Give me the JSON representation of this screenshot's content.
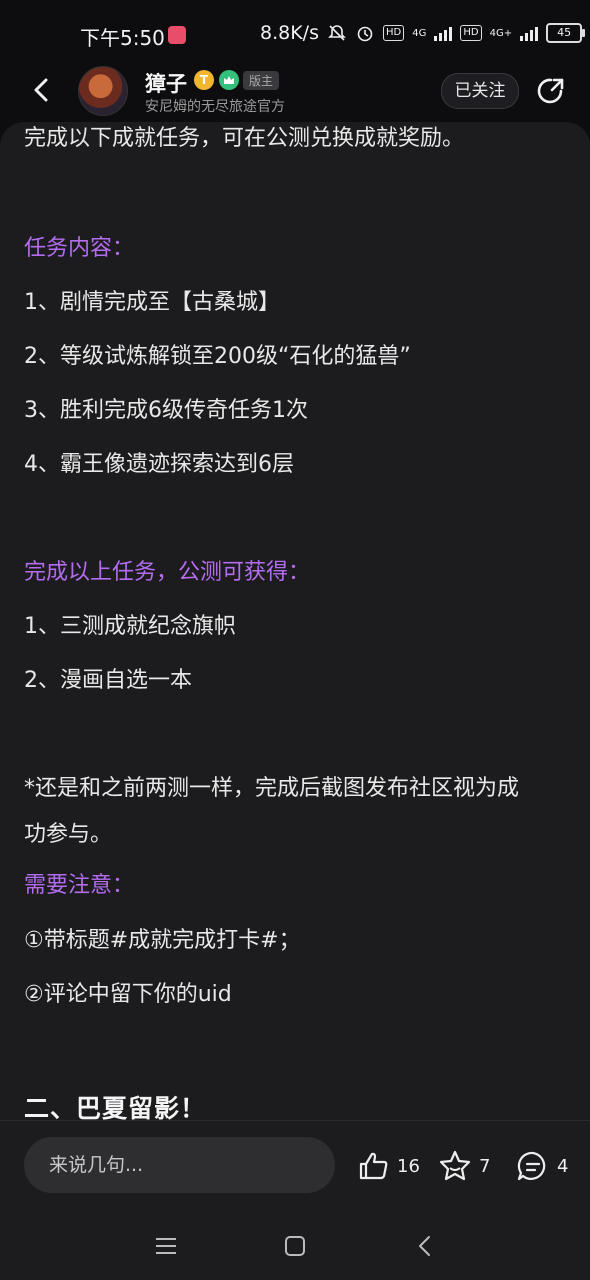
{
  "status_bar": {
    "time": "下午5:50",
    "speed": "8.8K/s",
    "hd1": "HD",
    "net1": "4G",
    "hd2": "HD",
    "net2": "4G+",
    "battery": "45"
  },
  "header": {
    "author_name": "獐子",
    "badge_t": "T",
    "mod_tag": "版主",
    "author_sub": "安尼姆的无尽旅途官方",
    "follow_label": "已关注"
  },
  "post": {
    "intro": "完成以下成就任务，可在公测兑换成就奖励。",
    "task_heading": "任务内容：",
    "tasks": [
      "1、剧情完成至【古桑城】",
      "2、等级试炼解锁至200级“石化的猛兽”",
      "3、胜利完成6级传奇任务1次",
      "4、霸王像遗迹探索达到6层"
    ],
    "reward_heading": "完成以上任务，公测可获得：",
    "rewards": [
      "1、三测成就纪念旗帜",
      "2、漫画自选一本"
    ],
    "note_line1": "*还是和之前两测一样，完成后截图发布社区视为成",
    "note_line2": "功参与。",
    "attention_heading": "需要注意：",
    "attention": [
      "①带标题#成就完成打卡#；",
      "②评论中留下你的uid"
    ],
    "section_title": "二、巴夏留影！"
  },
  "bottom": {
    "comment_placeholder": "来说几句...",
    "likes": "16",
    "favorites": "7",
    "comments": "4"
  },
  "colors": {
    "accent_purple": "#b46cf0",
    "background": "#1c1c1e"
  },
  "icons": [
    "back-icon",
    "share-icon",
    "like-icon",
    "star-icon",
    "comment-icon",
    "menu-icon",
    "home-icon",
    "nav-back-icon"
  ]
}
